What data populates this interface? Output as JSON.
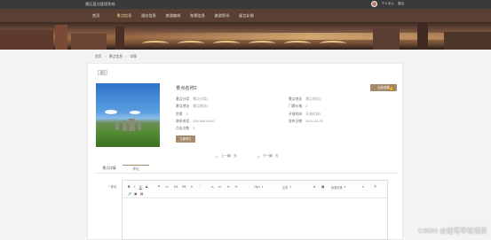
{
  "header": {
    "site_title": "景区盘点管理系统",
    "user_link": "个人中心",
    "logout_link": "退出"
  },
  "nav": {
    "items": [
      "首页",
      "景点信息",
      "酒店信息",
      "旅游路线",
      "车票信息",
      "旅游资讯",
      "留言反馈"
    ],
    "active_index": 1
  },
  "breadcrumb": [
    "首页",
    "景点信息",
    "详情"
  ],
  "back_button": "返回",
  "spot": {
    "name": "景点名称2",
    "favorite_button": "点我收藏",
    "fields_left": [
      {
        "label": "景点分类",
        "value": "景点分类2"
      },
      {
        "label": "景点地址",
        "value": "景点地址2"
      },
      {
        "label": "余票",
        "value": "2"
      },
      {
        "label": "联系电话",
        "value": "028-88810000"
      },
      {
        "label": "点击次数",
        "value": "3"
      }
    ],
    "fields_right": [
      {
        "label": "景点地址",
        "value": "景点地址2"
      },
      {
        "label": "门票价格",
        "value": "2"
      },
      {
        "label": "开放时间",
        "value": "开放时间2"
      },
      {
        "label": "发布日期",
        "value": "2024-03-28"
      }
    ],
    "book_button": "立即预订"
  },
  "pager": {
    "prev": "上一篇：无",
    "next": "下一篇：无"
  },
  "tabs": [
    "景点详情",
    "评论"
  ],
  "active_tab": 1,
  "comment": {
    "label": "* 评论",
    "toolbar_font_size": "14px",
    "toolbar_text": "文本",
    "toolbar_font_family": "标准字体"
  },
  "watermark": "CSDN @迪可毕设项目",
  "colors": {
    "topbar": "#3a3a3a",
    "navbar": "#5a4032",
    "accent": "#a48a6a"
  }
}
